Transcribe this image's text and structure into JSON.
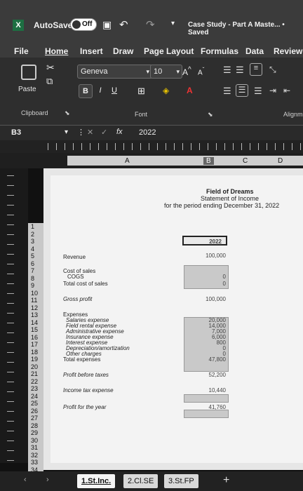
{
  "titlebar": {
    "autosave_label": "AutoSave",
    "autosave_state": "Off",
    "file_title": "Case Study - Part A Maste... • Saved"
  },
  "ribbon": {
    "tabs": [
      "File",
      "Home",
      "Insert",
      "Draw",
      "Page Layout",
      "Formulas",
      "Data",
      "Review"
    ],
    "paste_label": "Paste",
    "clipboard_label": "Clipboard",
    "font_group_label": "Font",
    "align_group_label": "Alignm",
    "font_name": "Geneva",
    "font_size": "10",
    "bold": "B",
    "italic": "I",
    "underline": "U"
  },
  "formulabar": {
    "name_box": "B3",
    "fx": "fx",
    "formula_value": "2022"
  },
  "columns": [
    "A",
    "B",
    "C",
    "D"
  ],
  "rows": [
    "1",
    "2",
    "3",
    "4",
    "5",
    "6",
    "7",
    "8",
    "9",
    "10",
    "11",
    "12",
    "13",
    "14",
    "15",
    "16",
    "17",
    "18",
    "19",
    "20",
    "21",
    "22",
    "23",
    "24",
    "25",
    "26",
    "27",
    "28",
    "29",
    "30",
    "31",
    "32",
    "33",
    "34"
  ],
  "statement": {
    "title": "Field of Dreams",
    "subtitle": "Statement of Income",
    "period": "for the period ending December 31, 2022",
    "year_header": "2022",
    "lines": [
      {
        "label": "Revenue",
        "value": "100,000"
      },
      {
        "label": "Cost of sales",
        "value": ""
      },
      {
        "label": "COGS",
        "value": "0"
      },
      {
        "label": "Total cost of sales",
        "value": "0"
      },
      {
        "label": "Gross profit",
        "value": "100,000"
      },
      {
        "label": "Expenses",
        "value": ""
      },
      {
        "label": "Salaries expense",
        "value": "20,000"
      },
      {
        "label": "Field rental expense",
        "value": "14,000"
      },
      {
        "label": "Administrative expense",
        "value": "7,000"
      },
      {
        "label": "Insurance expense",
        "value": "6,000"
      },
      {
        "label": "Interest expense",
        "value": "800"
      },
      {
        "label": "Depreciation/amortization",
        "value": "0"
      },
      {
        "label": "Other charges",
        "value": "0"
      },
      {
        "label": "Total expenses",
        "value": "47,800"
      },
      {
        "label": "Profit before taxes",
        "value": "52,200"
      },
      {
        "label": "Income tax expense",
        "value": "10,440"
      },
      {
        "label": "Profit for the year",
        "value": "41,760"
      }
    ]
  },
  "sheet_tabs": [
    "1.St.Inc.",
    "2.Cl.SE",
    "3.St.FP"
  ],
  "add_sheet": "+"
}
